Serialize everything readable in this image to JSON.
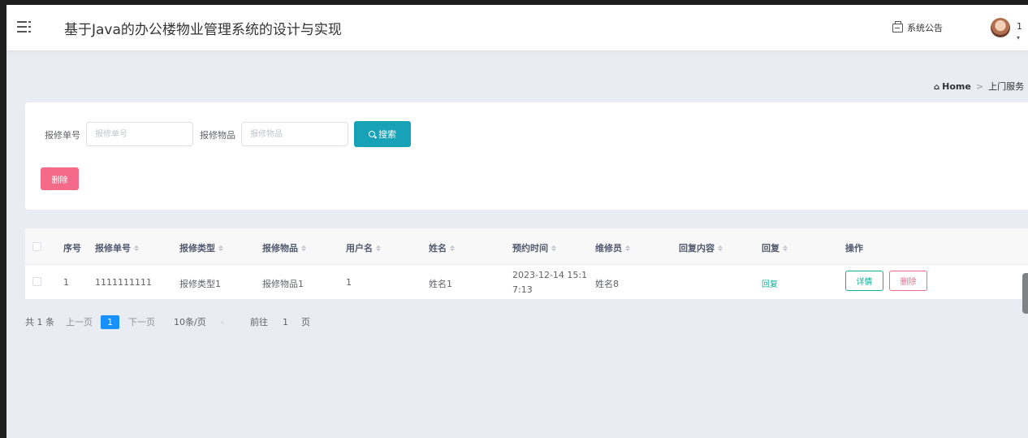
{
  "header": {
    "title": "基于Java的办公楼物业管理系统的设计与实现",
    "notice_label": "系统公告",
    "user_label": "1"
  },
  "breadcrumb": {
    "home": "Home",
    "separator": ">",
    "current": "上门服务"
  },
  "search": {
    "repair_no_label": "报修单号",
    "repair_no_placeholder": "报修单号",
    "repair_no_value": "",
    "item_label": "报修物品",
    "item_placeholder": "报修物品",
    "item_value": "",
    "search_button": "搜索",
    "delete_button": "删除"
  },
  "table": {
    "columns": [
      "序号",
      "报修单号",
      "报修类型",
      "报修物品",
      "用户名",
      "姓名",
      "预约时间",
      "维修员",
      "回复内容",
      "回复",
      "操作"
    ],
    "rows": [
      {
        "index": "1",
        "repair_no": "1111111111",
        "type": "报修类型1",
        "item": "报修物品1",
        "username": "1",
        "name": "姓名1",
        "time_line1": "2023-12-14 15:1",
        "time_line2": "7:13",
        "repairman": "姓名8",
        "reply_content": "",
        "reply": "回复",
        "detail_button": "详情",
        "delete_button": "删除"
      }
    ]
  },
  "pagination": {
    "total": "共 1 条",
    "prev": "上一页",
    "current_page": "1",
    "next": "下一页",
    "page_size": "10条/页",
    "goto_prefix": "前往",
    "goto_page": "1",
    "goto_suffix": "页"
  },
  "colors": {
    "primary": "#18a2b8",
    "danger": "#f46b8a",
    "success": "#13ae9a",
    "page_active": "#1890ff",
    "background": "#e9edf3"
  }
}
